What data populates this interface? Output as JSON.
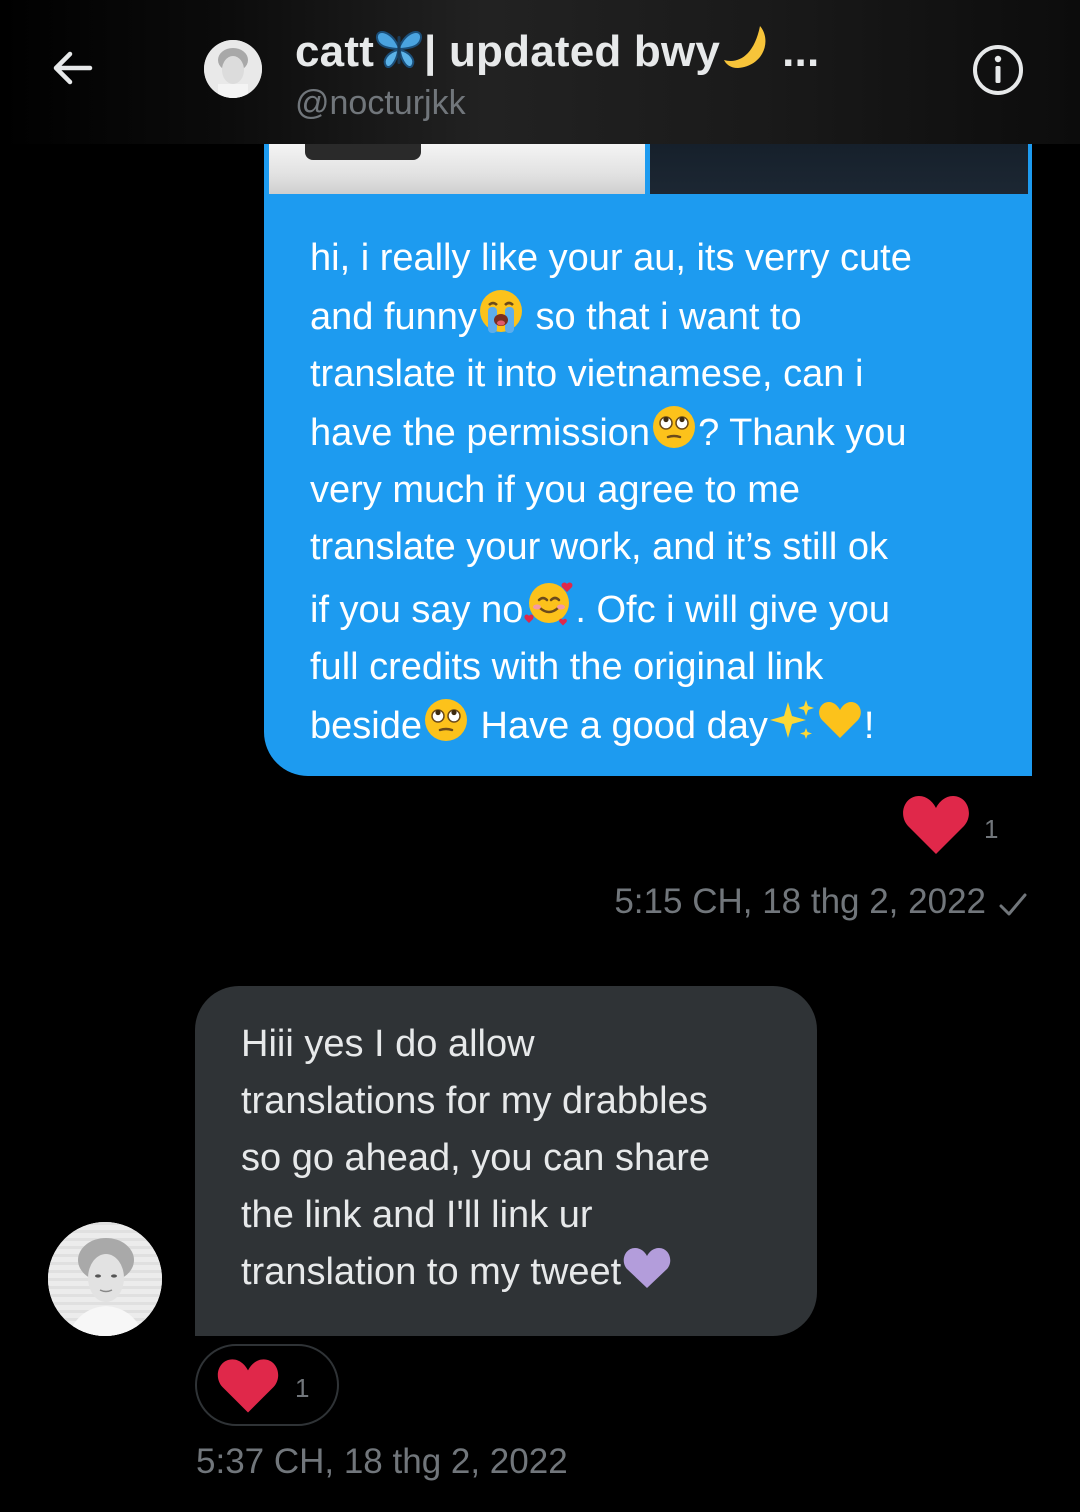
{
  "header": {
    "title_name": "catt",
    "title_rest": "| updated bwy",
    "title_ellipsis": "...",
    "handle": "@nocturjkk"
  },
  "messages": {
    "outgoing": {
      "line1": "hi, i really like your au, its verry cute",
      "line2a": "and funny",
      "line2b": " so that i want to",
      "line3": "translate it into vietnamese, can i",
      "line4a": "have the permission",
      "line4b": "? Thank you",
      "line5": "very much if you agree to me",
      "line6": "translate your work, and it’s still ok",
      "line7a": "if you say no",
      "line7b": ". Ofc i will give you",
      "line8": "full credits with the original link",
      "line9a": "beside",
      "line9b": " Have a good day",
      "line9c": "!",
      "reaction_count": "1",
      "timestamp": "5:15 CH, 18 thg 2, 2022"
    },
    "incoming": {
      "text": "Hiii yes I do allow\ntranslations for my drabbles\nso go ahead, you can share\nthe link and I'll link ur\ntranslation to my tweet",
      "reaction_count": "1",
      "timestamp": "5:37 CH, 18 thg 2, 2022"
    }
  },
  "colors": {
    "background": "#000000",
    "outgoing_bubble": "#1d9bf0",
    "incoming_bubble": "#2f3336",
    "muted_text": "#71767b",
    "heart": "#e0284a"
  },
  "icons": {
    "back": "arrow-left-icon",
    "info": "info-circle-icon",
    "read_receipt": "checkmark-icon",
    "reaction": "red-heart-icon"
  }
}
